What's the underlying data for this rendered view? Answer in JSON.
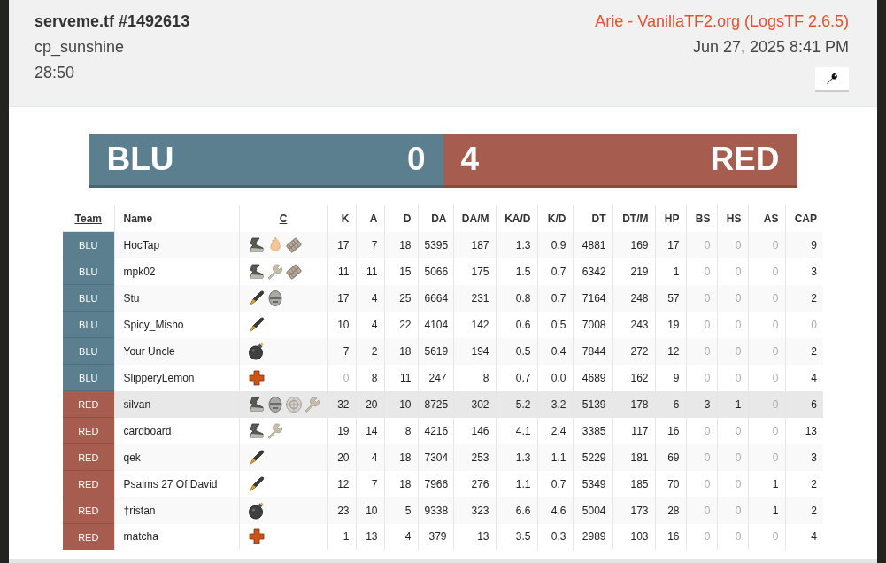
{
  "header": {
    "title": "serveme.tf #1492613",
    "map": "cp_sunshine",
    "duration": "28:50",
    "uploader": "Arie - VanillaTF2.org (LogsTF 2.6.5)",
    "date": "Jun 27, 2025 8:41 PM"
  },
  "score": {
    "blu": {
      "name": "BLU",
      "score": "0"
    },
    "red": {
      "name": "RED",
      "score": "4"
    }
  },
  "table": {
    "columns": [
      {
        "label": "Team",
        "sortable": true
      },
      {
        "label": "Name",
        "sortable": false
      },
      {
        "label": "C",
        "sortable": true
      },
      {
        "label": "K",
        "sortable": false
      },
      {
        "label": "A",
        "sortable": false
      },
      {
        "label": "D",
        "sortable": false
      },
      {
        "label": "DA",
        "sortable": false
      },
      {
        "label": "DA/M",
        "sortable": false
      },
      {
        "label": "KA/D",
        "sortable": false
      },
      {
        "label": "K/D",
        "sortable": false
      },
      {
        "label": "DT",
        "sortable": false
      },
      {
        "label": "DT/M",
        "sortable": false
      },
      {
        "label": "HP",
        "sortable": false
      },
      {
        "label": "BS",
        "sortable": false
      },
      {
        "label": "HS",
        "sortable": false
      },
      {
        "label": "AS",
        "sortable": false
      },
      {
        "label": "CAP",
        "sortable": false
      }
    ],
    "rows": [
      {
        "team": "BLU",
        "name": "HocTap",
        "selected": false,
        "classes": [
          {
            "kind": "boot"
          },
          {
            "kind": "flame"
          },
          {
            "kind": "grid"
          }
        ],
        "stats": [
          "17",
          "7",
          "18",
          "5395",
          "187",
          "1.3",
          "0.9",
          "4881",
          "169",
          "17",
          "0",
          "0",
          "0",
          "9"
        ]
      },
      {
        "team": "BLU",
        "name": "mpk02",
        "selected": false,
        "classes": [
          {
            "kind": "boot"
          },
          {
            "kind": "wrench"
          },
          {
            "kind": "grid"
          }
        ],
        "stats": [
          "11",
          "11",
          "15",
          "5066",
          "175",
          "1.5",
          "0.7",
          "6342",
          "219",
          "1",
          "0",
          "0",
          "0",
          "3"
        ]
      },
      {
        "team": "BLU",
        "name": "Stu",
        "selected": false,
        "classes": [
          {
            "kind": "rocket"
          },
          {
            "kind": "mask"
          }
        ],
        "stats": [
          "17",
          "4",
          "25",
          "6664",
          "231",
          "0.8",
          "0.7",
          "7164",
          "248",
          "57",
          "0",
          "0",
          "0",
          "2"
        ]
      },
      {
        "team": "BLU",
        "name": "Spicy_Misho",
        "selected": false,
        "classes": [
          {
            "kind": "rocket"
          }
        ],
        "stats": [
          "10",
          "4",
          "22",
          "4104",
          "142",
          "0.6",
          "0.5",
          "7008",
          "243",
          "19",
          "0",
          "0",
          "0",
          "0"
        ]
      },
      {
        "team": "BLU",
        "name": "Your Uncle",
        "selected": false,
        "classes": [
          {
            "kind": "bomb"
          }
        ],
        "stats": [
          "7",
          "2",
          "18",
          "5619",
          "194",
          "0.5",
          "0.4",
          "7844",
          "272",
          "12",
          "0",
          "0",
          "0",
          "2"
        ]
      },
      {
        "team": "BLU",
        "name": "SlipperyLemon",
        "selected": false,
        "classes": [
          {
            "kind": "cross"
          }
        ],
        "stats": [
          "0",
          "8",
          "11",
          "247",
          "8",
          "0.7",
          "0.0",
          "4689",
          "162",
          "9",
          "0",
          "0",
          "0",
          "4"
        ]
      },
      {
        "team": "RED",
        "name": "silvan",
        "selected": true,
        "classes": [
          {
            "kind": "boot"
          },
          {
            "kind": "mask"
          },
          {
            "kind": "target"
          },
          {
            "kind": "wrench"
          }
        ],
        "stats": [
          "32",
          "20",
          "10",
          "8725",
          "302",
          "5.2",
          "3.2",
          "5139",
          "178",
          "6",
          "3",
          "1",
          "0",
          "6"
        ]
      },
      {
        "team": "RED",
        "name": "cardboard",
        "selected": false,
        "classes": [
          {
            "kind": "boot"
          },
          {
            "kind": "wrench"
          }
        ],
        "stats": [
          "19",
          "14",
          "8",
          "4216",
          "146",
          "4.1",
          "2.4",
          "3385",
          "117",
          "16",
          "0",
          "0",
          "0",
          "13"
        ]
      },
      {
        "team": "RED",
        "name": "qek",
        "selected": false,
        "classes": [
          {
            "kind": "rocket"
          }
        ],
        "stats": [
          "20",
          "4",
          "18",
          "7304",
          "253",
          "1.3",
          "1.1",
          "5229",
          "181",
          "69",
          "0",
          "0",
          "0",
          "3"
        ]
      },
      {
        "team": "RED",
        "name": "Psalms 27 Of David",
        "selected": false,
        "classes": [
          {
            "kind": "rocket"
          }
        ],
        "stats": [
          "12",
          "7",
          "18",
          "7966",
          "276",
          "1.1",
          "0.7",
          "5349",
          "185",
          "70",
          "0",
          "0",
          "1",
          "2"
        ]
      },
      {
        "team": "RED",
        "name": "†ristan",
        "selected": false,
        "classes": [
          {
            "kind": "bomb"
          }
        ],
        "stats": [
          "23",
          "10",
          "5",
          "9338",
          "323",
          "6.6",
          "4.6",
          "5004",
          "173",
          "28",
          "0",
          "0",
          "1",
          "2"
        ]
      },
      {
        "team": "RED",
        "name": "matcha",
        "selected": false,
        "classes": [
          {
            "kind": "cross"
          }
        ],
        "stats": [
          "1",
          "13",
          "4",
          "379",
          "13",
          "3.5",
          "0.3",
          "2989",
          "103",
          "16",
          "0",
          "0",
          "0",
          "4"
        ]
      }
    ]
  }
}
